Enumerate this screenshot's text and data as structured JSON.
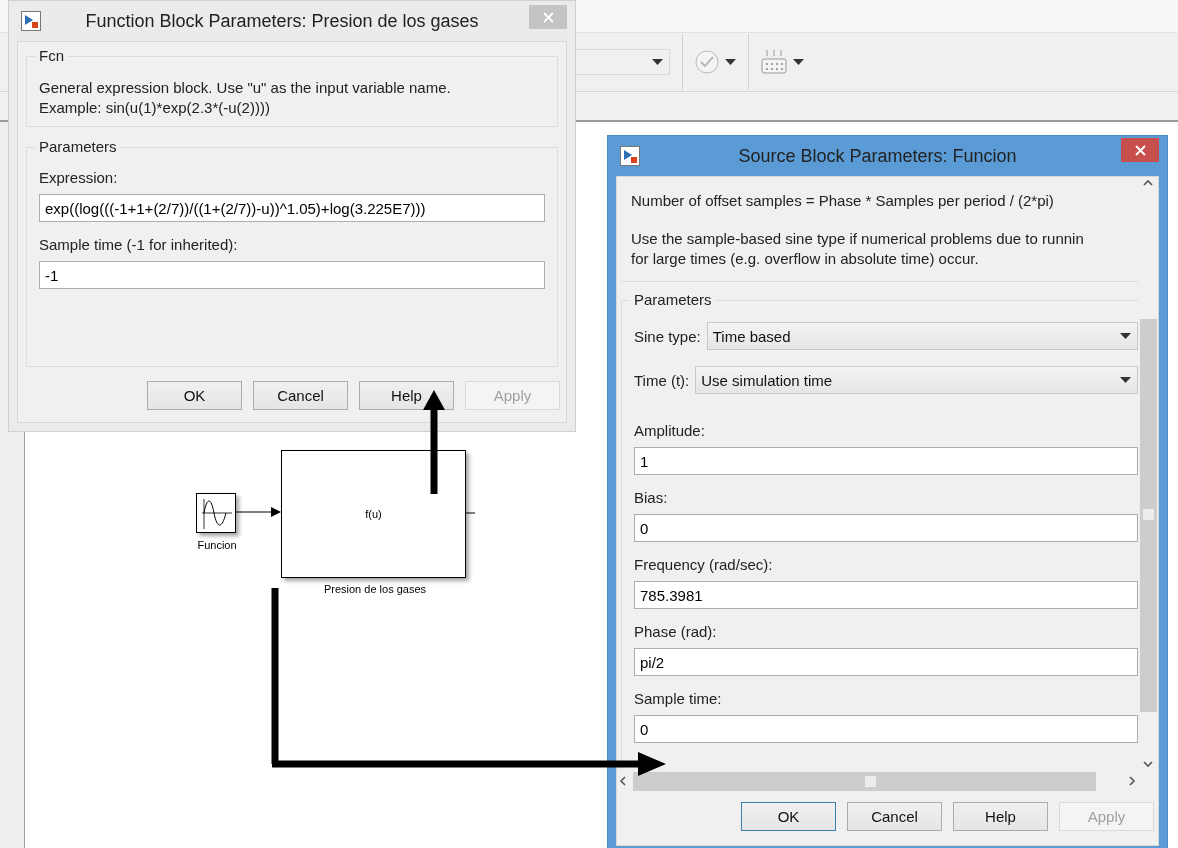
{
  "model": {
    "blocks": [
      {
        "kind": "sine",
        "label": "Funcion"
      },
      {
        "kind": "fcn",
        "text": "f(u)",
        "label": "Presion de los gases"
      }
    ]
  },
  "fcn_dialog": {
    "title": "Function Block Parameters: Presion de los gases",
    "active": false,
    "description": {
      "title": "Fcn",
      "paragraphs": [
        "General expression block. Use \"u\" as the input variable name.\nExample: sin(u(1)*exp(2.3*(-u(2))))"
      ]
    },
    "parameters": {
      "title": "Parameters",
      "fields": [
        {
          "kind": "text",
          "label": "Expression:",
          "value": "exp((log(((-1+1+(2/7))/((1+(2/7))-u))^1.05)+log(3.225E7)))"
        },
        {
          "kind": "text",
          "label": "Sample time (-1 for inherited):",
          "value": "-1"
        }
      ]
    },
    "buttons": [
      {
        "label": "OK",
        "disabled": false,
        "default": false
      },
      {
        "label": "Cancel",
        "disabled": false,
        "default": false
      },
      {
        "label": "Help",
        "disabled": false,
        "default": false
      },
      {
        "label": "Apply",
        "disabled": true,
        "default": false
      }
    ]
  },
  "source_dialog": {
    "title": "Source Block Parameters: Funcion",
    "active": true,
    "description": {
      "paragraphs": [
        "Number of offset samples = Phase * Samples per period / (2*pi)",
        "Use the sample-based sine type if numerical problems due to runnin\nfor large times (e.g. overflow in absolute time) occur."
      ]
    },
    "parameters": {
      "title": "Parameters",
      "fields": [
        {
          "kind": "select",
          "label": "Sine type:",
          "value": "Time based"
        },
        {
          "kind": "select",
          "label": "Time (t):",
          "value": "Use simulation time"
        },
        {
          "kind": "text",
          "label": "Amplitude:",
          "value": "1"
        },
        {
          "kind": "text",
          "label": "Bias:",
          "value": "0"
        },
        {
          "kind": "text",
          "label": "Frequency (rad/sec):",
          "value": "785.3981"
        },
        {
          "kind": "text",
          "label": "Phase (rad):",
          "value": "pi/2"
        },
        {
          "kind": "text",
          "label": "Sample time:",
          "value": "0"
        }
      ]
    },
    "buttons": [
      {
        "label": "OK",
        "disabled": false,
        "default": true
      },
      {
        "label": "Cancel",
        "disabled": false,
        "default": false
      },
      {
        "label": "Help",
        "disabled": false,
        "default": false
      },
      {
        "label": "Apply",
        "disabled": true,
        "default": false
      }
    ]
  }
}
